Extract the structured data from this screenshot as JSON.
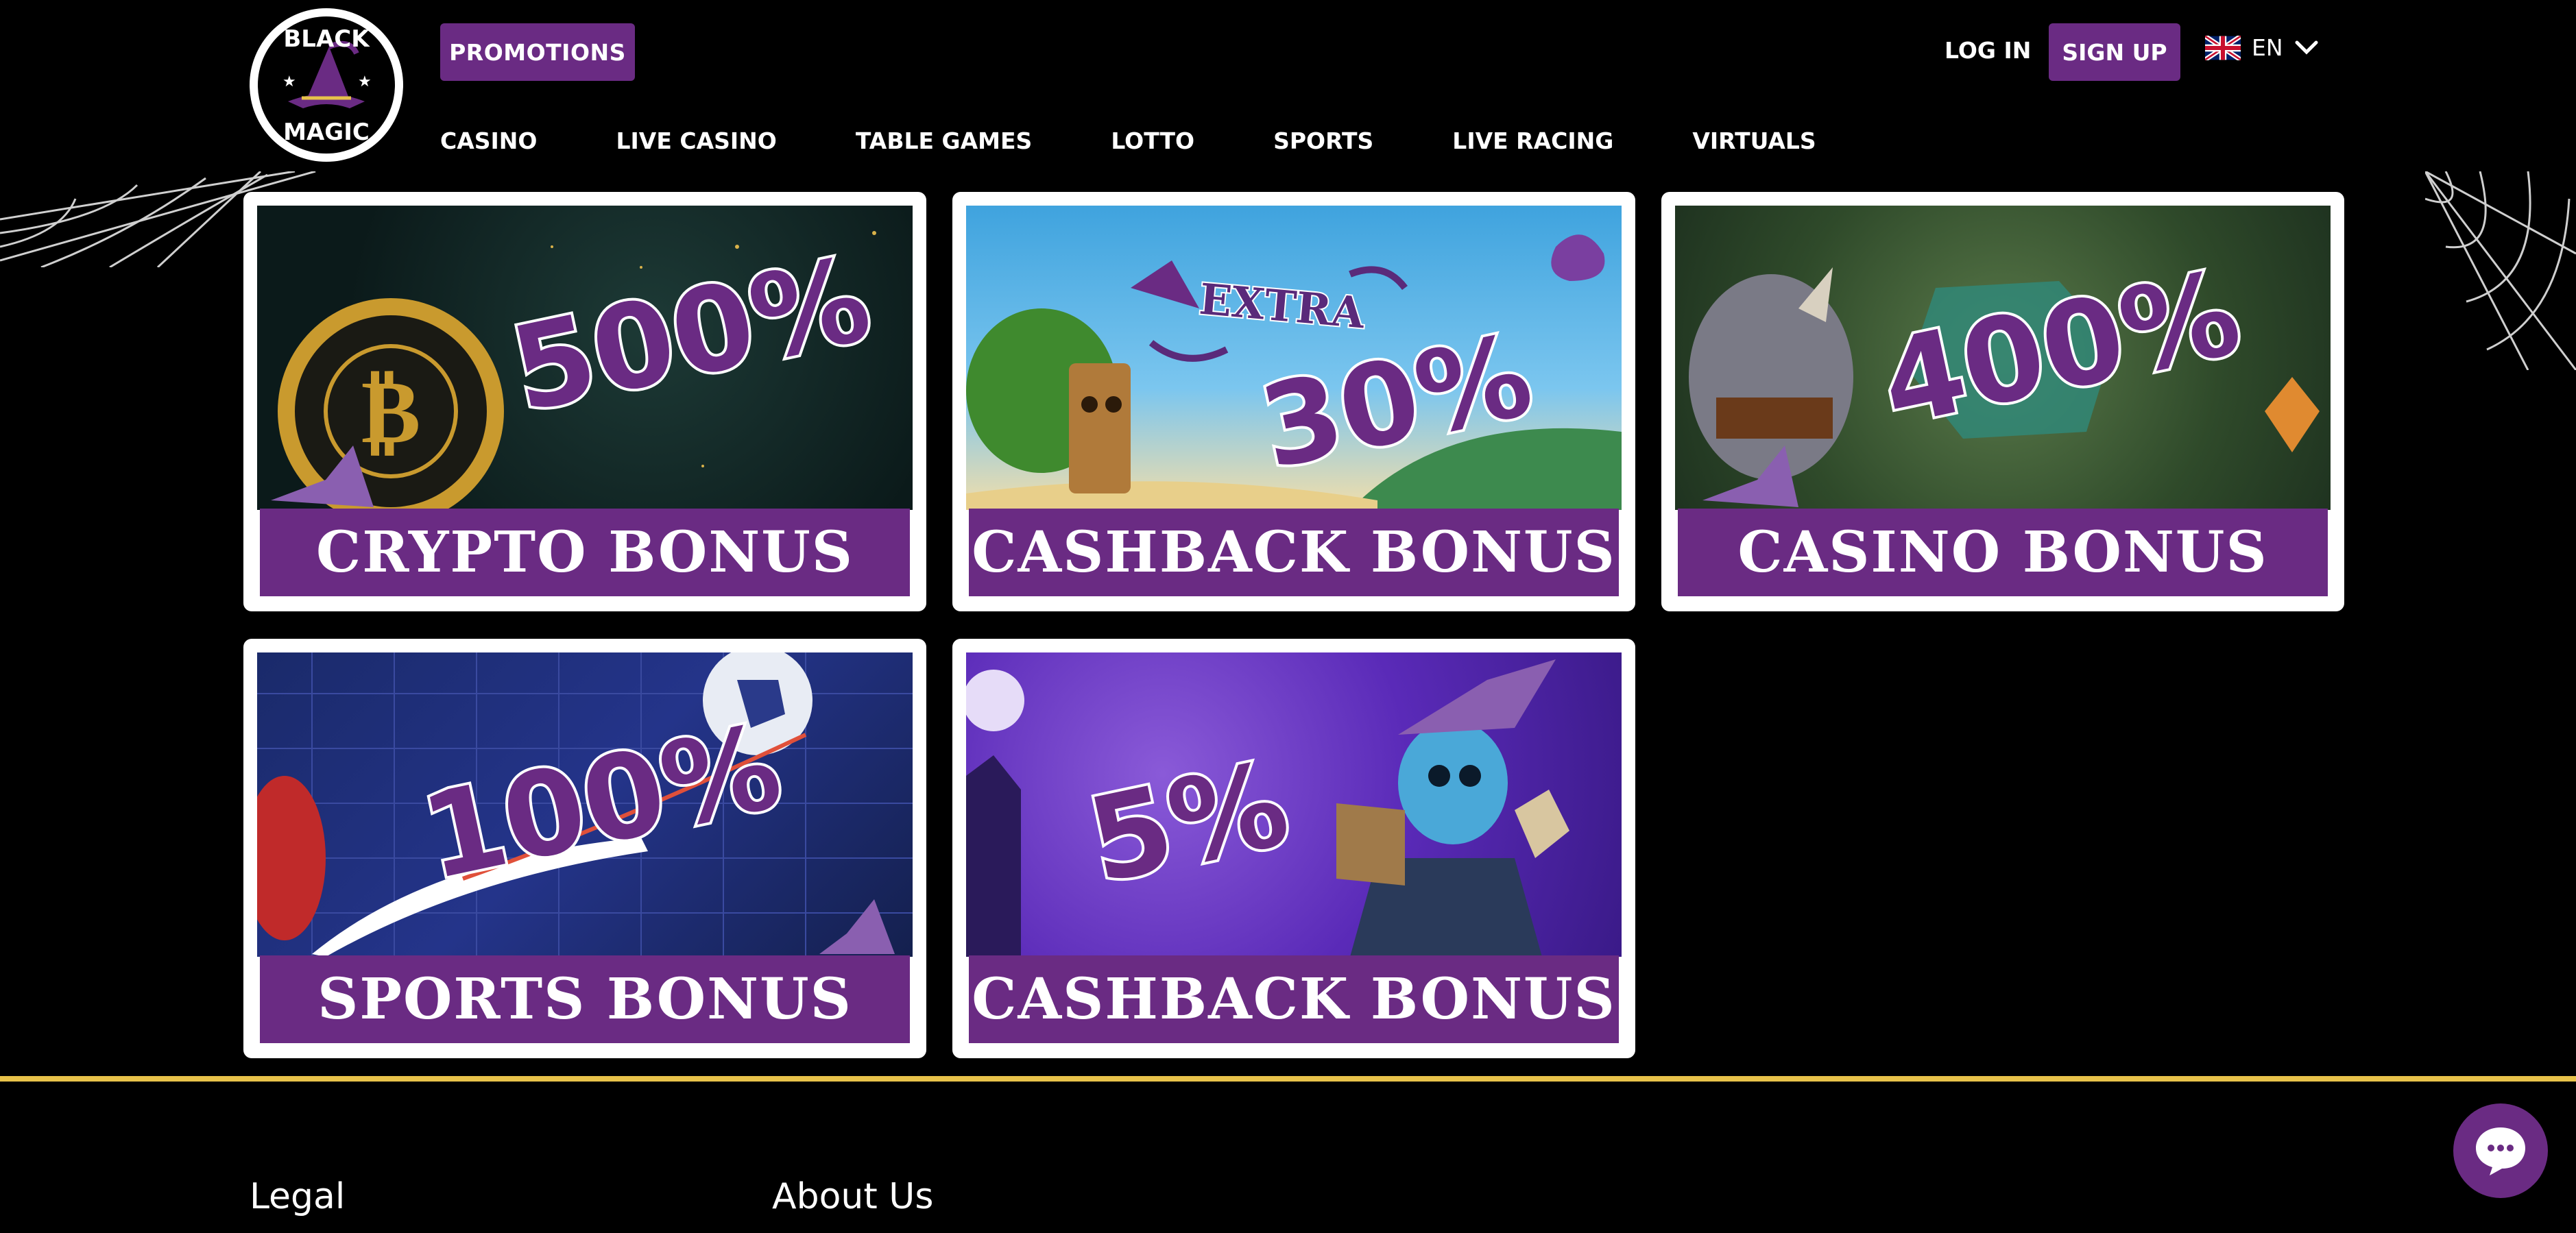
{
  "brand": {
    "logo_text_top": "BLACK",
    "logo_text_bottom": "MAGIC"
  },
  "header": {
    "promotions_label": "PROMOTIONS",
    "login_label": "LOG IN",
    "signup_label": "SIGN UP",
    "language": "EN"
  },
  "nav": {
    "items": [
      "CASINO",
      "LIVE CASINO",
      "TABLE GAMES",
      "LOTTO",
      "SPORTS",
      "LIVE RACING",
      "VIRTUALS"
    ]
  },
  "promos": [
    {
      "percent": "500%",
      "title": "CRYPTO BONUS"
    },
    {
      "percent": "30%",
      "extra": "EXTRA",
      "title": "CASHBACK BONUS"
    },
    {
      "percent": "400%",
      "title": "CASINO BONUS"
    },
    {
      "percent": "100%",
      "title": "SPORTS BONUS"
    },
    {
      "percent": "5%",
      "title": "CASHBACK BONUS"
    }
  ],
  "footer": {
    "legal_heading": "Legal",
    "about_heading": "About Us"
  },
  "colors": {
    "brand_purple": "#6a2b83",
    "footer_accent": "#e7c24a",
    "background": "#000000"
  },
  "icons": {
    "language_flag": "uk-flag-icon",
    "language_toggle": "chevron-down-icon",
    "chat": "chat-bubble-icon"
  }
}
